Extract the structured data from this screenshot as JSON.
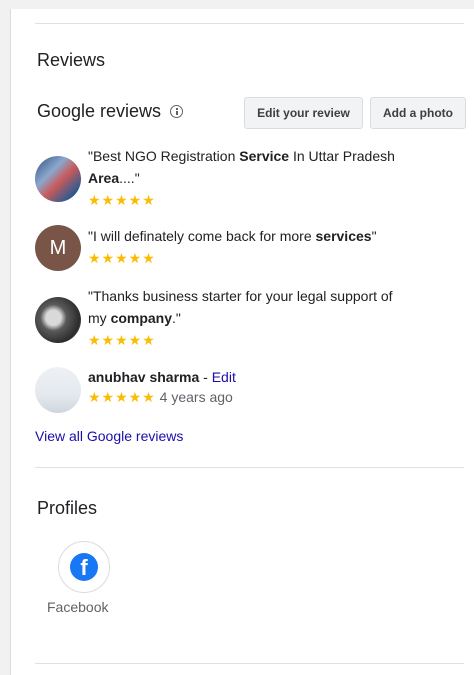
{
  "reviews_section": {
    "heading": "Reviews",
    "google_reviews_title": "Google reviews",
    "edit_review_btn": "Edit your review",
    "add_photo_btn": "Add a photo",
    "items": [
      {
        "pre": "\"Best NGO Registration ",
        "bold": "Service",
        "post": " In Uttar Pradesh",
        "line2_bold": "Area",
        "line2_post": "....\"",
        "stars": "★★★★★"
      },
      {
        "avatar_letter": "M",
        "pre": "\"I will definately come back for more ",
        "bold": "services",
        "post": "\"",
        "stars": "★★★★★"
      },
      {
        "pre": "\"Thanks business starter for your legal support of",
        "line2_pre": "my ",
        "line2_bold": "company",
        "line2_post": ".\"",
        "stars": "★★★★★"
      }
    ],
    "own_review": {
      "name": "anubhav sharma",
      "separator": " - ",
      "edit_label": "Edit",
      "stars": "★★★★★",
      "time": "4 years ago"
    },
    "view_all": "View all Google reviews"
  },
  "profiles_section": {
    "heading": "Profiles",
    "items": [
      {
        "label": "Facebook",
        "icon": "facebook-icon",
        "color": "#1877f2"
      }
    ]
  },
  "colors": {
    "star": "#fbbc04",
    "link": "#1a0dab",
    "avatar_m": "#795548"
  }
}
